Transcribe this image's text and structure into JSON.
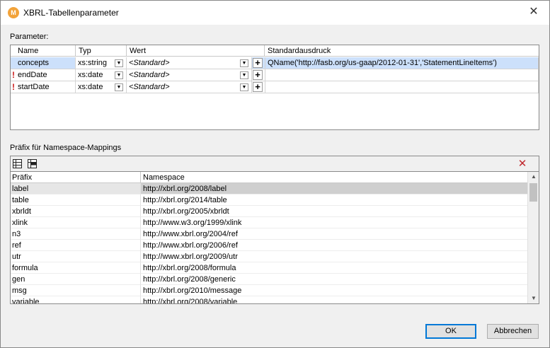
{
  "window": {
    "title": "XBRL-Tabellenparameter",
    "close_glyph": "✕"
  },
  "icons": {
    "app": "altova-app-icon",
    "close": "close-icon",
    "required": "required-icon"
  },
  "colors": {
    "selection": "#cce0fb",
    "required": "#cc1a1a",
    "ok_border": "#0078d7"
  },
  "parameters": {
    "label": "Parameter:",
    "columns": [
      "Name",
      "Typ",
      "Wert",
      "Standardausdruck"
    ],
    "rows": [
      {
        "name": "concepts",
        "type": "xs:string",
        "value": "<Standard>",
        "default_expr": "QName('http://fasb.org/us-gaap/2012-01-31','StatementLineItems')",
        "required": false,
        "selected": true
      },
      {
        "name": "endDate",
        "type": "xs:date",
        "value": "<Standard>",
        "default_expr": "",
        "required": true,
        "selected": false
      },
      {
        "name": "startDate",
        "type": "xs:date",
        "value": "<Standard>",
        "default_expr": "",
        "required": true,
        "selected": false
      }
    ]
  },
  "namespaces": {
    "label": "Präfix für Namespace-Mappings",
    "columns": [
      "Präfix",
      "Namespace"
    ],
    "rows": [
      {
        "prefix": "label",
        "namespace": "http://xbrl.org/2008/label",
        "selected": true
      },
      {
        "prefix": "table",
        "namespace": "http://xbrl.org/2014/table"
      },
      {
        "prefix": "xbrldt",
        "namespace": "http://xbrl.org/2005/xbrldt"
      },
      {
        "prefix": "xlink",
        "namespace": "http://www.w3.org/1999/xlink"
      },
      {
        "prefix": "n3",
        "namespace": "http://www.xbrl.org/2004/ref"
      },
      {
        "prefix": "ref",
        "namespace": "http://www.xbrl.org/2006/ref"
      },
      {
        "prefix": "utr",
        "namespace": "http://www.xbrl.org/2009/utr"
      },
      {
        "prefix": "formula",
        "namespace": "http://xbrl.org/2008/formula"
      },
      {
        "prefix": "gen",
        "namespace": "http://xbrl.org/2008/generic"
      },
      {
        "prefix": "msg",
        "namespace": "http://xbrl.org/2010/message"
      },
      {
        "prefix": "variable",
        "namespace": "http://xbrl.org/2008/variable"
      }
    ]
  },
  "buttons": {
    "ok": "OK",
    "cancel": "Abbrechen"
  }
}
